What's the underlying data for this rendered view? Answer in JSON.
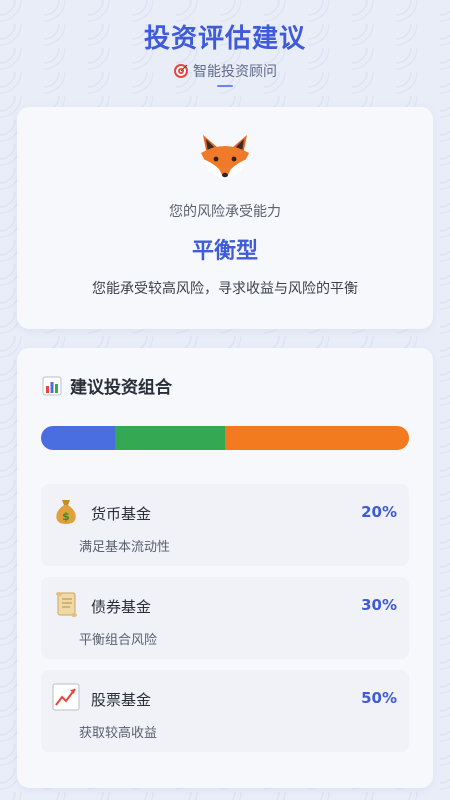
{
  "header": {
    "title": "投资评估建议",
    "subtitle": "智能投资顾问",
    "subtitle_icon": "target-icon"
  },
  "profile": {
    "avatar_icon": "fox-icon",
    "label": "您的风险承受能力",
    "type": "平衡型",
    "description": "您能承受较高风险，寻求收益与风险的平衡"
  },
  "portfolio": {
    "title": "建议投资组合",
    "title_icon": "bar-chart-icon",
    "allocation": [
      {
        "fraction": 0.2,
        "color": "#4a6ee0"
      },
      {
        "fraction": 0.3,
        "color": "#34a853"
      },
      {
        "fraction": 0.5,
        "color": "#f37a1f"
      }
    ],
    "funds": [
      {
        "icon": "money-bag-icon",
        "name": "货币基金",
        "percent": "20%",
        "description": "满足基本流动性"
      },
      {
        "icon": "scroll-icon",
        "name": "债券基金",
        "percent": "30%",
        "description": "平衡组合风险"
      },
      {
        "icon": "trend-chart-icon",
        "name": "股票基金",
        "percent": "50%",
        "description": "获取较高收益"
      }
    ]
  },
  "colors": {
    "accent": "#3f5bd8",
    "background": "#e9edf8"
  }
}
